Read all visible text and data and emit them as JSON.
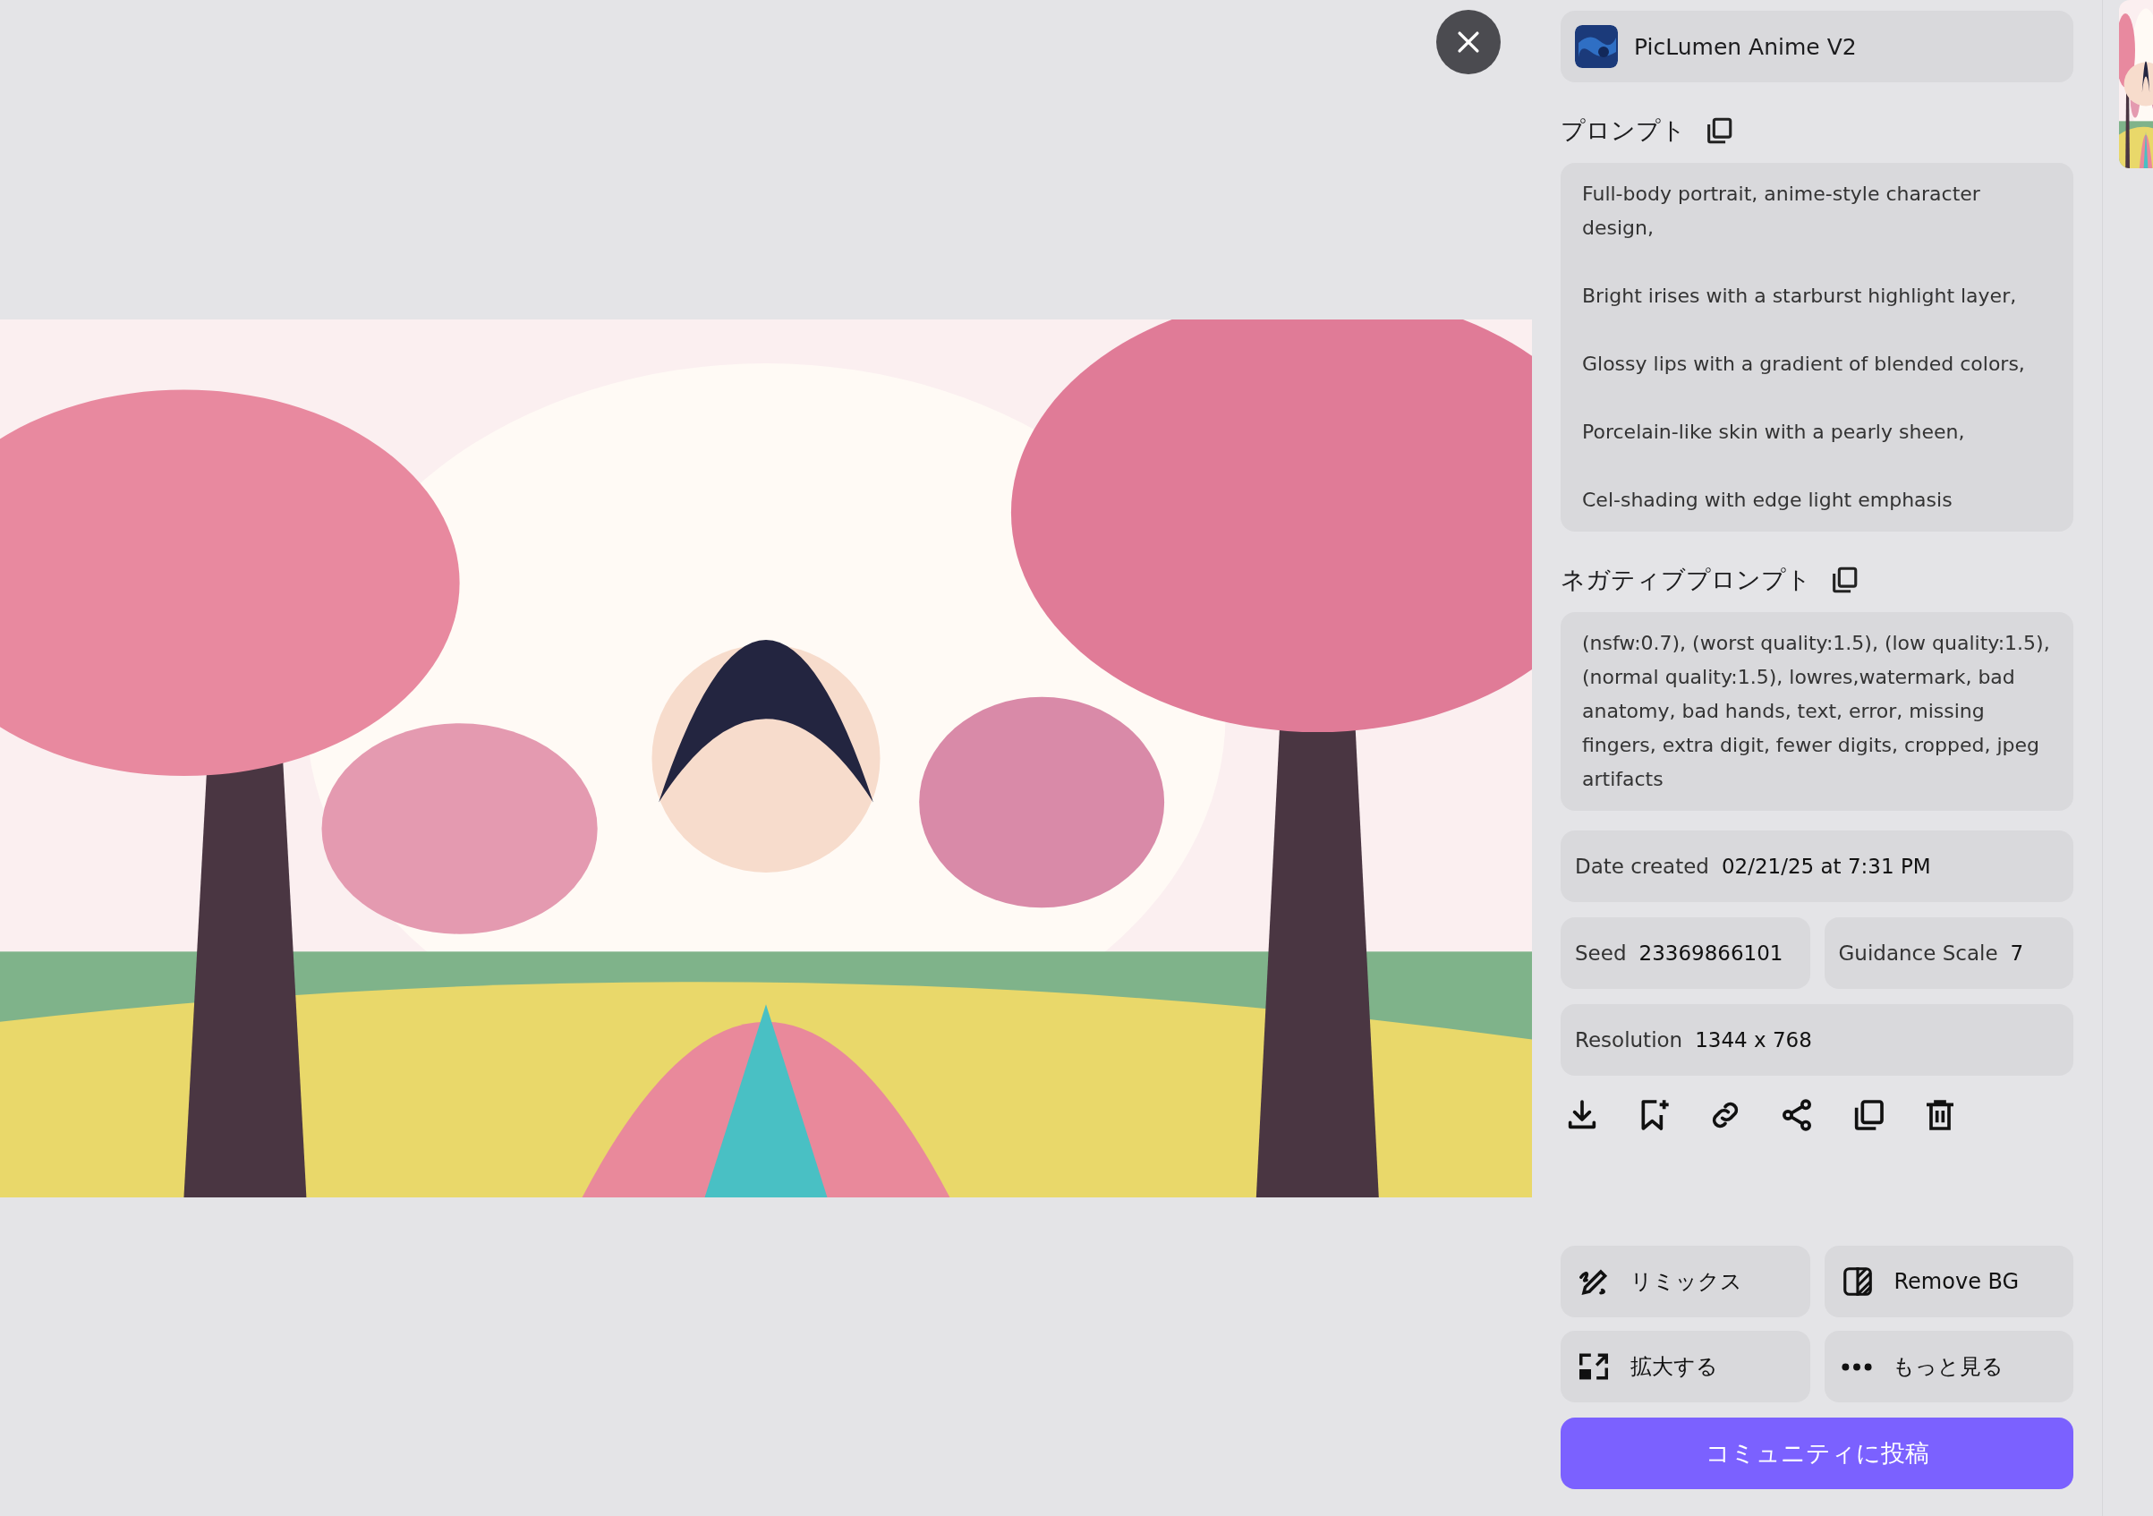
{
  "model": {
    "name": "PicLumen Anime V2"
  },
  "prompt": {
    "heading": "プロンプト",
    "paragraphs": [
      "Full-body portrait, anime-style character design,",
      "Bright irises with a starburst highlight layer,",
      "Glossy lips with a gradient of blended colors,",
      "Porcelain-like skin with a pearly sheen,",
      "Cel-shading with edge light emphasis"
    ]
  },
  "negative_prompt": {
    "heading": "ネガティブプロンプト",
    "text": "(nsfw:0.7), (worst quality:1.5), (low quality:1.5), (normal quality:1.5), lowres,watermark, bad anatomy, bad hands, text, error, missing fingers, extra digit, fewer digits, cropped, jpeg artifacts"
  },
  "details": [
    [
      {
        "label": "Date created",
        "value": "02/21/25 at 7:31 PM"
      }
    ],
    [
      {
        "label": "Seed",
        "value": "23369866101"
      },
      {
        "label": "Guidance Scale",
        "value": "7"
      }
    ],
    [
      {
        "label": "Resolution",
        "value": "1344 x 768"
      }
    ]
  ],
  "actions": [
    {
      "kind": "remix",
      "label": "リミックス"
    },
    {
      "kind": "remove_bg",
      "label": "Remove BG"
    },
    {
      "kind": "upscale",
      "label": "拡大する"
    },
    {
      "kind": "more",
      "label": "もっと見る"
    }
  ],
  "post_button": {
    "label": "コミュニティに投稿"
  }
}
